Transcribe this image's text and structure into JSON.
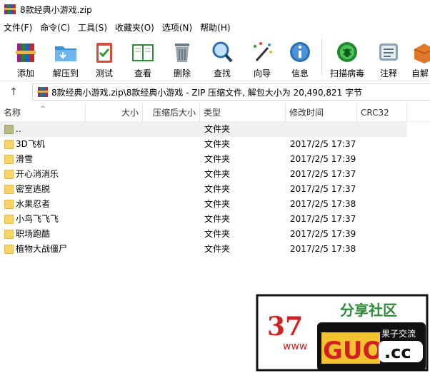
{
  "window": {
    "title": "8款经典小游戏.zip"
  },
  "menu": [
    "文件(F)",
    "命令(C)",
    "工具(S)",
    "收藏夹(O)",
    "选项(N)",
    "帮助(H)"
  ],
  "toolbar": {
    "add": "添加",
    "extract": "解压到",
    "test": "测试",
    "view": "查看",
    "delete": "删除",
    "find": "查找",
    "wizard": "向导",
    "info": "信息",
    "scan": "扫描病毒",
    "comment": "注释",
    "sfx": "自解"
  },
  "address": {
    "path": "8款经典小游戏.zip\\8款经典小游戏 - ZIP 压缩文件, 解包大小为 20,490,821 字节"
  },
  "columns": {
    "name": "名称",
    "size": "大小",
    "packed": "压缩后大小",
    "type": "类型",
    "modified": "修改时间",
    "crc": "CRC32"
  },
  "rows": [
    {
      "name": "..",
      "type": "文件夹",
      "modified": ""
    },
    {
      "name": "3D飞机",
      "type": "文件夹",
      "modified": "2017/2/5 17:37"
    },
    {
      "name": "滑雪",
      "type": "文件夹",
      "modified": "2017/2/5 17:39"
    },
    {
      "name": "开心消消乐",
      "type": "文件夹",
      "modified": "2017/2/5 17:37"
    },
    {
      "name": "密室逃脱",
      "type": "文件夹",
      "modified": "2017/2/5 17:37"
    },
    {
      "name": "水果忍者",
      "type": "文件夹",
      "modified": "2017/2/5 17:38"
    },
    {
      "name": "小鸟飞飞飞",
      "type": "文件夹",
      "modified": "2017/2/5 17:37"
    },
    {
      "name": "职场跑酷",
      "type": "文件夹",
      "modified": "2017/2/5 17:39"
    },
    {
      "name": "植物大战僵尸",
      "type": "文件夹",
      "modified": "2017/2/5 17:38"
    }
  ],
  "watermark": {
    "brand_left": "37",
    "brand_site": "www",
    "brand_right": "GUO",
    "brand_tld": ".cc",
    "brand_tag": "果子交流",
    "brand_top": "分享社区"
  },
  "colors": {
    "selected_row": "#f0f0f0",
    "folder": "#f9d46a",
    "header_border": "#e5e5e5"
  }
}
